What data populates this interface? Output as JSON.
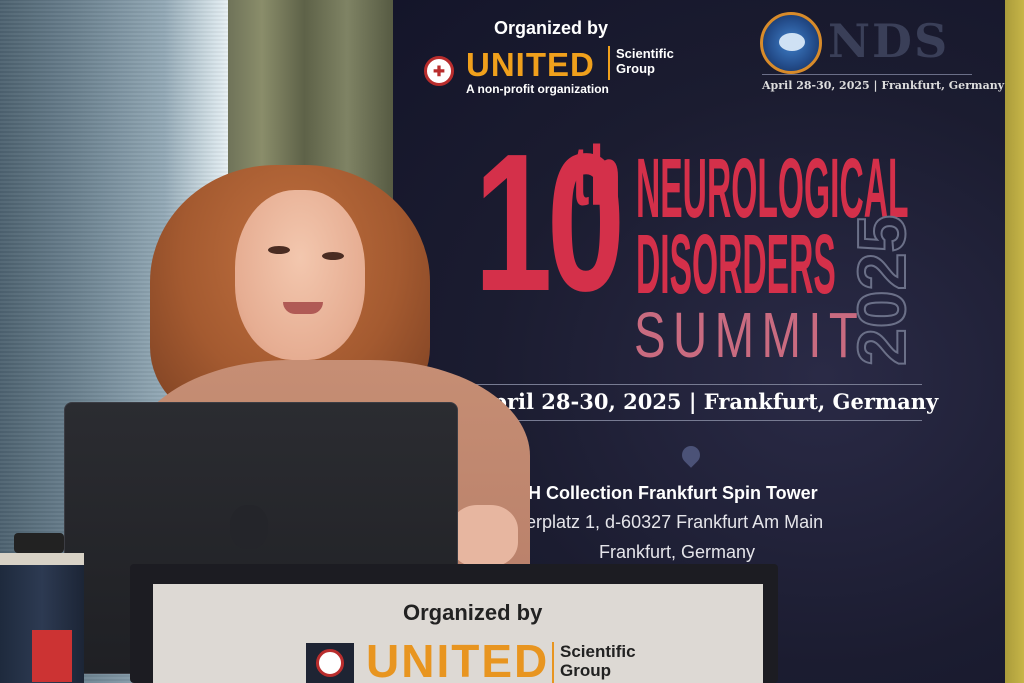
{
  "banner": {
    "organized_by": "Organized by",
    "org_name": "UNITED",
    "org_suffix_line1": "Scientific",
    "org_suffix_line2": "Group",
    "org_tagline": "A non-profit organization",
    "series_mark": "NDS",
    "top_date": "April 28-30, 2025 | Frankfurt, Germany",
    "edition_number": "10",
    "edition_suffix": "th",
    "title_line1": "NEUROLOGICAL",
    "title_line2": "DISORDERS",
    "title_line3": "SUMMIT",
    "year": "2025",
    "dateline": "April 28-30, 2025 | Frankfurt, Germany",
    "venue_name": "NH Collection Frankfurt Spin Tower",
    "address_line1": "Güterplatz 1, d-60327 Frankfurt Am Main",
    "address_line2": "Frankfurt, Germany",
    "accent_color": "#d4304a",
    "org_color": "#f0a01c"
  },
  "lectern_sign": {
    "organized_by": "Organized by",
    "org_name": "UNITED",
    "org_suffix_line1": "Scientific",
    "org_suffix_line2": "Group"
  }
}
